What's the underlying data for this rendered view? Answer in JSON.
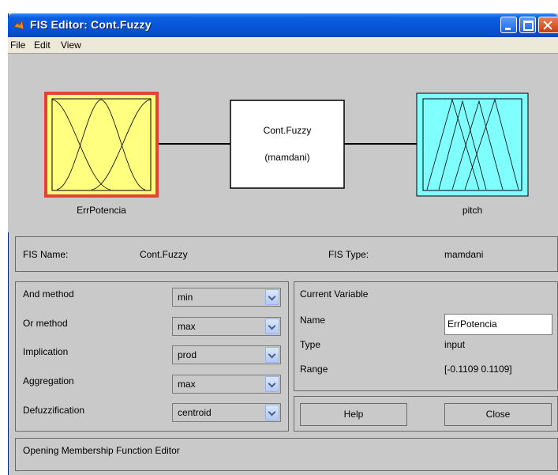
{
  "window": {
    "title": "FIS Editor: Cont.Fuzzy"
  },
  "menu": {
    "file": "File",
    "edit": "Edit",
    "view": "View"
  },
  "diagram": {
    "input_name": "ErrPotencia",
    "system_name": "Cont.Fuzzy",
    "system_type": "(mamdani)",
    "output_name": "pitch",
    "input_color": "#ffff80",
    "input_border_color": "#e34234",
    "output_color": "#80ffff"
  },
  "fis_info": {
    "name_label": "FIS Name:",
    "name_value": "Cont.Fuzzy",
    "type_label": "FIS Type:",
    "type_value": "mamdani"
  },
  "methods": {
    "and_label": "And method",
    "and_value": "min",
    "or_label": "Or method",
    "or_value": "max",
    "implication_label": "Implication",
    "implication_value": "prod",
    "aggregation_label": "Aggregation",
    "aggregation_value": "max",
    "defuzz_label": "Defuzzification",
    "defuzz_value": "centroid"
  },
  "current_variable": {
    "header": "Current Variable",
    "name_label": "Name",
    "name_value": "ErrPotencia",
    "type_label": "Type",
    "type_value": "input",
    "range_label": "Range",
    "range_value": "[-0.1109 0.1109]"
  },
  "buttons": {
    "help": "Help",
    "close": "Close"
  },
  "status": {
    "message": "Opening Membership Function Editor"
  }
}
